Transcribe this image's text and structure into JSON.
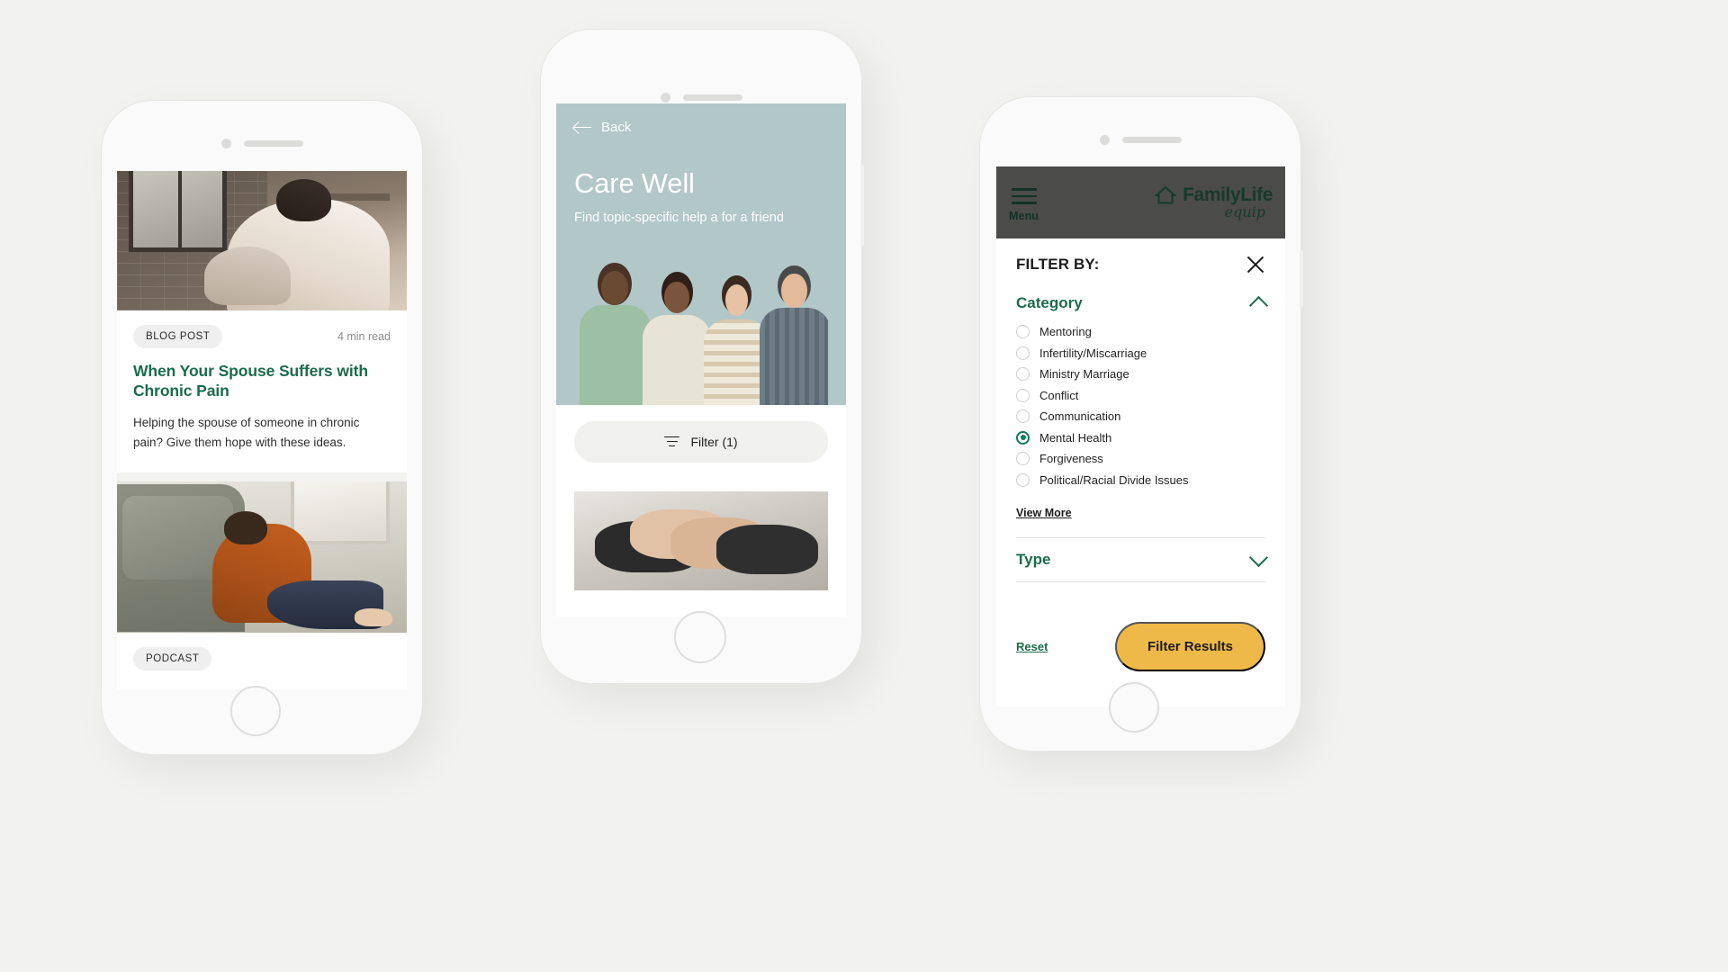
{
  "scene": {
    "background": "#f2f2f0",
    "accent_green": "#1b6b4c",
    "accent_yellow": "#efb949",
    "hero_blue": "#b2c7c8",
    "appbar_gray": "#4b4b4a"
  },
  "phone1": {
    "name": "Article list screen",
    "cards": [
      {
        "badge": "BLOG POST",
        "readtime": "4 min read",
        "title": "When Your Spouse Suffers with Chronic Pain",
        "description": "Helping the spouse of someone in chronic pain? Give them hope with these ideas.",
        "image_alt": "woman-sitting-by-window-photo"
      },
      {
        "badge": "PODCAST",
        "readtime": "",
        "title": "",
        "description": "",
        "image_alt": "woman-sitting-on-floor-by-couch-photo"
      }
    ]
  },
  "phone2": {
    "name": "Care Well topic screen",
    "back_label": "Back",
    "hero_title": "Care Well",
    "hero_subtitle": "Find topic-specific help a for a friend",
    "hero_image_alt": "four-friends-arms-around-shoulders-photo",
    "filter_button": "Filter (1)",
    "result_image_alt": "clasped-hands-photo"
  },
  "phone3": {
    "name": "Filter panel screen",
    "appbar": {
      "menu_label": "Menu",
      "brand": "FamilyLife",
      "brand_sub": "equip"
    },
    "panel_title": "FILTER BY:",
    "close_label": "close",
    "sections": [
      {
        "title": "Category",
        "expanded": true,
        "options": [
          {
            "label": "Mentoring",
            "selected": false
          },
          {
            "label": "Infertility/Miscarriage",
            "selected": false
          },
          {
            "label": "Ministry Marriage",
            "selected": false
          },
          {
            "label": "Conflict",
            "selected": false
          },
          {
            "label": "Communication",
            "selected": false
          },
          {
            "label": "Mental Health",
            "selected": true
          },
          {
            "label": "Forgiveness",
            "selected": false
          },
          {
            "label": "Political/Racial Divide Issues",
            "selected": false
          }
        ],
        "view_more": "View More"
      },
      {
        "title": "Type",
        "expanded": false,
        "options": [],
        "view_more": ""
      }
    ],
    "reset_label": "Reset",
    "submit_label": "Filter Results"
  }
}
